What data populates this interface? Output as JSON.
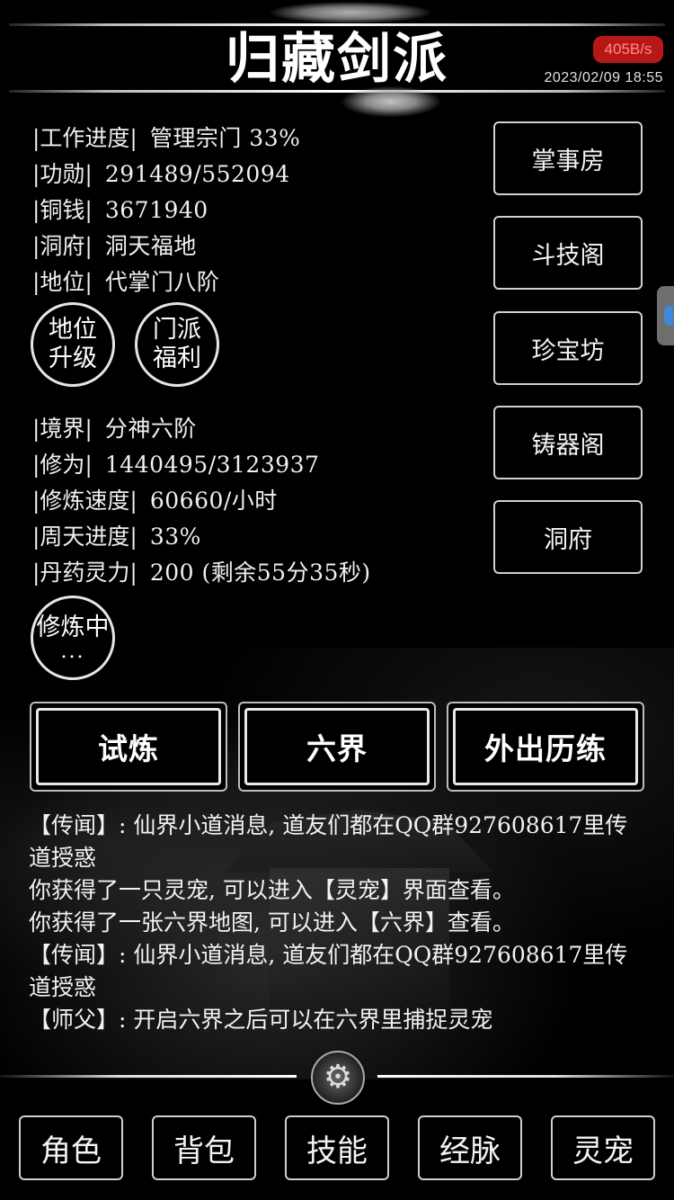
{
  "header": {
    "title": "归藏剑派",
    "net_speed": "405B/s",
    "datetime": "2023/02/09  18:55"
  },
  "sect_stats": [
    {
      "label": "|工作进度|",
      "value": "管理宗门 33%"
    },
    {
      "label": "|功勋|",
      "value": "291489/552094"
    },
    {
      "label": "|铜钱|",
      "value": "3671940"
    },
    {
      "label": "|洞府|",
      "value": "洞天福地"
    },
    {
      "label": "|地位|",
      "value": "代掌门八阶"
    }
  ],
  "rank_buttons": {
    "promote": [
      "地位",
      "升级"
    ],
    "welfare": [
      "门派",
      "福利"
    ]
  },
  "cultivation_stats": [
    {
      "label": "|境界|",
      "value": "分神六阶"
    },
    {
      "label": "|修为|",
      "value": "1440495/3123937"
    },
    {
      "label": "|修炼速度|",
      "value": "60660/小时"
    },
    {
      "label": "|周天进度|",
      "value": "33%"
    },
    {
      "label": "|丹药灵力|",
      "value": "200 (剩余55分35秒)"
    }
  ],
  "cultivate_button": {
    "line1": "修炼中",
    "line2": "..."
  },
  "side_menu": [
    "掌事房",
    "斗技阁",
    "珍宝坊",
    "铸器阁",
    "洞府"
  ],
  "actions": [
    "试炼",
    "六界",
    "外出历练"
  ],
  "log": [
    "【传闻】: 仙界小道消息, 道友们都在QQ群927608617里传道授惑",
    "你获得了一只灵宠, 可以进入【灵宠】界面查看。",
    "你获得了一张六界地图, 可以进入【六界】查看。",
    "【传闻】: 仙界小道消息, 道友们都在QQ群927608617里传道授惑",
    "【师父】: 开启六界之后可以在六界里捕捉灵宠"
  ],
  "settings_icon": "gear-icon",
  "bottom_nav": [
    "角色",
    "背包",
    "技能",
    "经脉",
    "灵宠"
  ],
  "colors": {
    "background": "#000000",
    "text": "#f0f0f0",
    "speed_badge": "#b81717"
  }
}
